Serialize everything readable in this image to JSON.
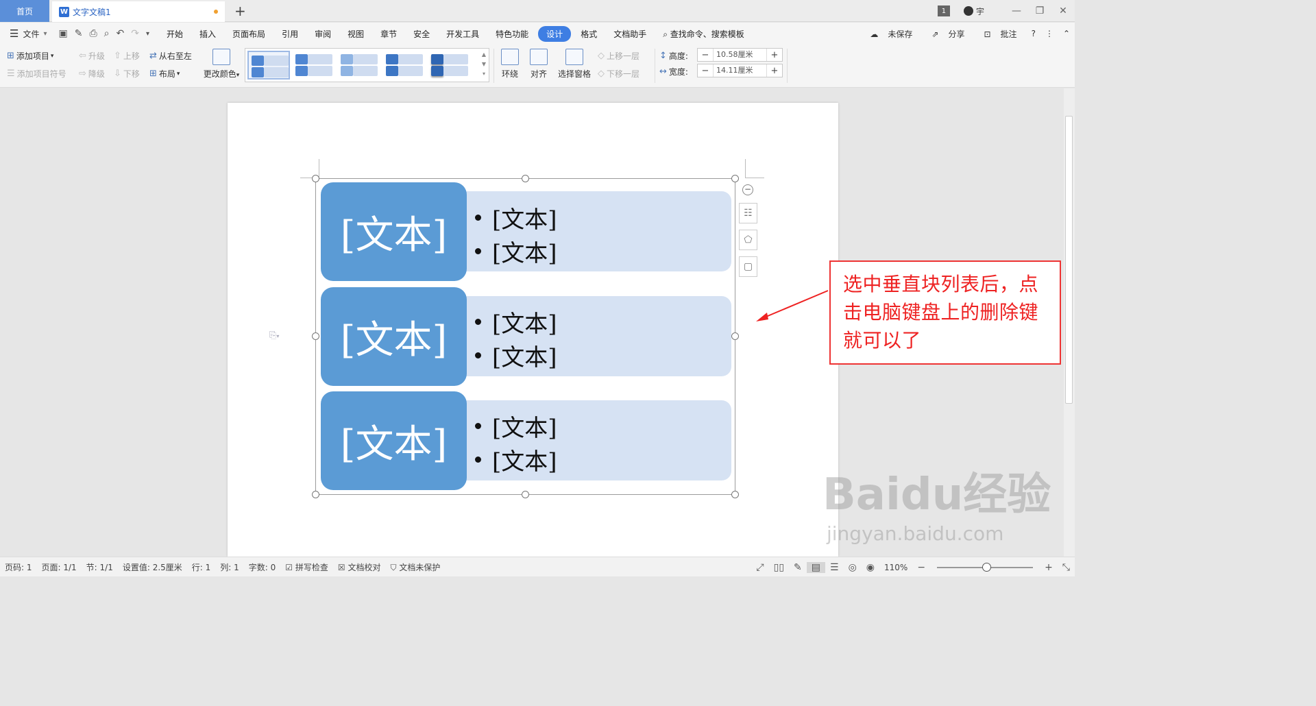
{
  "tabs": {
    "home": "首页",
    "doc": "文字文稿1",
    "count_badge": "1",
    "user": "宇"
  },
  "menu": {
    "file": "文件",
    "items": [
      "开始",
      "插入",
      "页面布局",
      "引用",
      "审阅",
      "视图",
      "章节",
      "安全",
      "开发工具",
      "特色功能",
      "设计",
      "格式",
      "文档助手"
    ],
    "active": "设计",
    "search": "查找命令、搜索模板",
    "unsaved": "未保存",
    "share": "分享",
    "comment": "批注"
  },
  "ribbon": {
    "add_item": "添加项目",
    "add_bullet": "添加项目符号",
    "promote": "升级",
    "demote": "降级",
    "move_up": "上移",
    "move_down": "下移",
    "rtl": "从右至左",
    "layout": "布局",
    "change_color": "更改颜色",
    "wrap": "环绕",
    "align": "对齐",
    "selection_pane": "选择窗格",
    "bring_forward": "上移一层",
    "send_backward": "下移一层",
    "height_label": "高度:",
    "height_value": "10.58厘米",
    "width_label": "宽度:",
    "width_value": "14.11厘米"
  },
  "smartart": {
    "rows": [
      {
        "main": "[文本]",
        "bullets": [
          "[文本]",
          "[文本]"
        ]
      },
      {
        "main": "[文本]",
        "bullets": [
          "[文本]",
          "[文本]"
        ]
      },
      {
        "main": "[文本]",
        "bullets": [
          "[文本]",
          "[文本]"
        ]
      }
    ]
  },
  "callout": {
    "line1": "选中垂直块列表后，点",
    "line2": "击电脑键盘上的删除键",
    "line3": "就可以了"
  },
  "watermark": {
    "logo": "Baidu经验",
    "url": "jingyan.baidu.com"
  },
  "status": {
    "page_no": "页码: 1",
    "pages": "页面: 1/1",
    "section": "节: 1/1",
    "setting": "设置值: 2.5厘米",
    "row": "行: 1",
    "col": "列: 1",
    "words": "字数: 0",
    "spell": "拼写检查",
    "proof": "文档校对",
    "protect": "文档未保护",
    "zoom": "110%"
  },
  "colors": {
    "accent": "#3e7ee3",
    "block_dark": "#5b9bd5",
    "block_light": "#d6e2f3",
    "callout": "#ee2222"
  }
}
